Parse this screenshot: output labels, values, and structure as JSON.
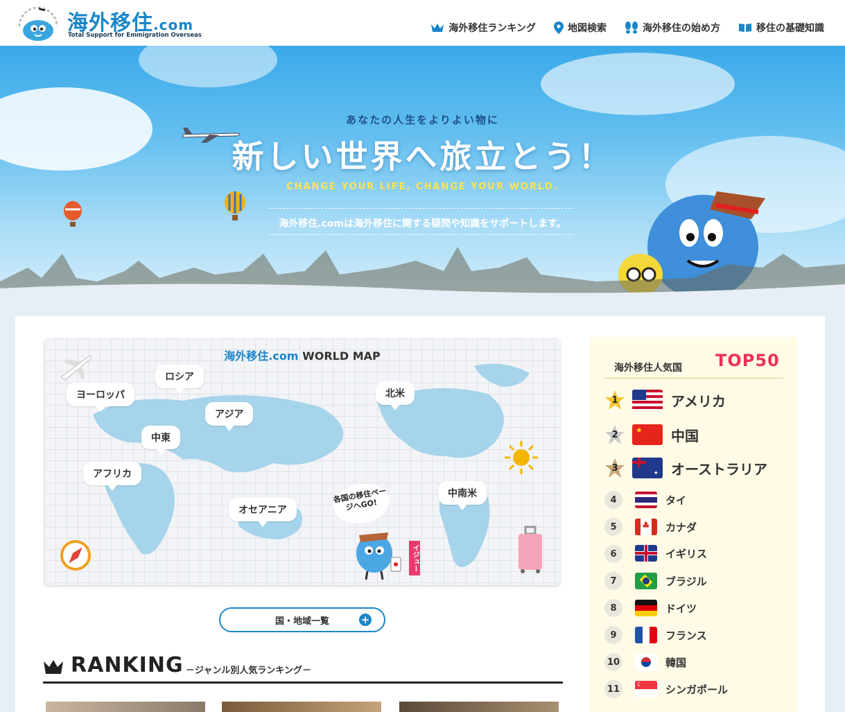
{
  "header": {
    "logo_title": "海外移住",
    "logo_com": ".com",
    "logo_sub": "Total Support for Emmigration Overseas",
    "nav": [
      {
        "label": "海外移住ランキング",
        "icon": "crown-icon"
      },
      {
        "label": "地図検索",
        "icon": "map-pin-icon"
      },
      {
        "label": "海外移住の始め方",
        "icon": "footprints-icon"
      },
      {
        "label": "移住の基礎知識",
        "icon": "book-icon"
      }
    ]
  },
  "hero": {
    "kicker": "あなたの人生をよりよい物に",
    "title": "新しい世界へ旅立とう！",
    "english": "CHANGE YOUR LIFE, CHANGE YOUR WORLD.",
    "description": "海外移住.comは海外移住に関する疑問や知識をサポートします。"
  },
  "map": {
    "title_brand": "海外移住.com",
    "title_rest": " WORLD MAP",
    "regions": [
      "ヨーロッパ",
      "ロシア",
      "アジア",
      "中東",
      "アフリカ",
      "オセアニア",
      "北米",
      "中南米"
    ],
    "mascot_bubble": "各国の移住ページへGO!",
    "mascot_tag": "イジュー"
  },
  "list_button": {
    "label": "国・地域一覧",
    "icon": "plus-circle-icon"
  },
  "ranking": {
    "title": "RANKING",
    "subtitle": "－ジャンル別人気ランキング－"
  },
  "sidebar": {
    "label": "海外移住人気国",
    "top": "TOP50",
    "countries": [
      {
        "rank": "1",
        "name": "アメリカ",
        "flag": "us-flag"
      },
      {
        "rank": "2",
        "name": "中国",
        "flag": "cn-flag"
      },
      {
        "rank": "3",
        "name": "オーストラリア",
        "flag": "au-flag"
      },
      {
        "rank": "4",
        "name": "タイ",
        "flag": "th-flag"
      },
      {
        "rank": "5",
        "name": "カナダ",
        "flag": "ca-flag"
      },
      {
        "rank": "6",
        "name": "イギリス",
        "flag": "gb-flag"
      },
      {
        "rank": "7",
        "name": "ブラジル",
        "flag": "br-flag"
      },
      {
        "rank": "8",
        "name": "ドイツ",
        "flag": "de-flag"
      },
      {
        "rank": "9",
        "name": "フランス",
        "flag": "fr-flag"
      },
      {
        "rank": "10",
        "name": "韓国",
        "flag": "kr-flag"
      },
      {
        "rank": "11",
        "name": "シンガポール",
        "flag": "sg-flag"
      }
    ]
  },
  "colors": {
    "brand": "#1a86c8",
    "accent": "#ee2f5a",
    "sidebar_bg": "#fffbe6"
  }
}
